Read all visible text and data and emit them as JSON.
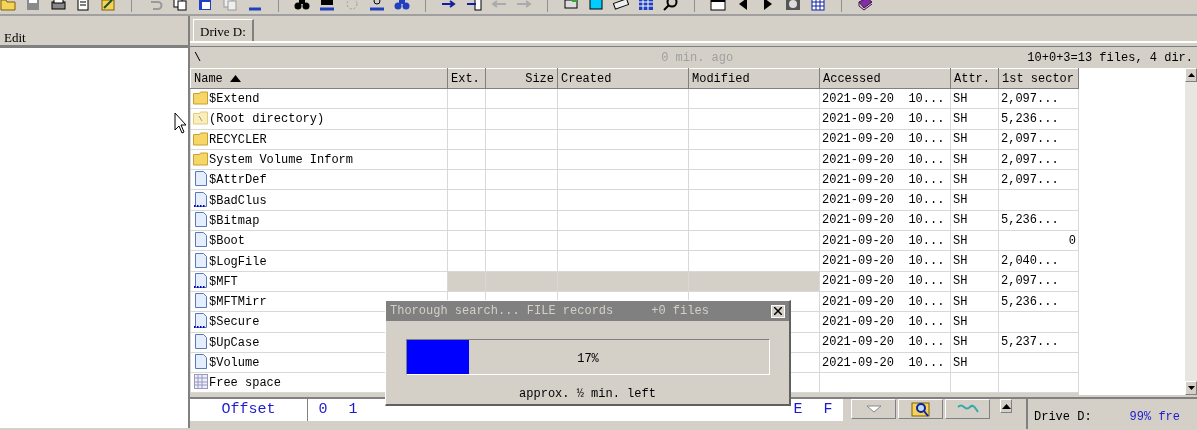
{
  "left_pane": {
    "menu": "Edit"
  },
  "tab": {
    "label": "Drive D:",
    "selected": true
  },
  "path_bar": {
    "path": "\\",
    "updated": "0 min. ago",
    "summary": "10+0+3=13 files, 4 dir."
  },
  "table": {
    "columns": [
      {
        "label": "Name",
        "sorted": true
      },
      {
        "label": "Ext.",
        "sorted": false
      },
      {
        "label": "Size",
        "sorted": false
      },
      {
        "label": "Created",
        "sorted": false
      },
      {
        "label": "Modified",
        "sorted": false
      },
      {
        "label": "Accessed",
        "sorted": false
      },
      {
        "label": "Attr.",
        "sorted": false
      },
      {
        "label": "1st sector",
        "sorted": false
      }
    ],
    "rows": [
      {
        "kind": "folder",
        "name": "$Extend",
        "accessed": "2021-09-20  10...",
        "attr": "SH",
        "first_sector": "2,097...",
        "selected": false
      },
      {
        "kind": "root",
        "name": "(Root directory)",
        "accessed": "2021-09-20  10...",
        "attr": "SH",
        "first_sector": "5,236...",
        "selected": false
      },
      {
        "kind": "folder",
        "name": "RECYCLER",
        "accessed": "2021-09-20  10...",
        "attr": "SH",
        "first_sector": "2,097...",
        "selected": false
      },
      {
        "kind": "folder",
        "name": "System Volume Inform",
        "accessed": "2021-09-20  10...",
        "attr": "SH",
        "first_sector": "2,097...",
        "selected": false
      },
      {
        "kind": "file",
        "name": "$AttrDef",
        "accessed": "2021-09-20  10...",
        "attr": "SH",
        "first_sector": "2,097...",
        "selected": false
      },
      {
        "kind": "partial",
        "name": "$BadClus",
        "accessed": "2021-09-20  10...",
        "attr": "SH",
        "selected": false
      },
      {
        "kind": "file",
        "name": "$Bitmap",
        "accessed": "2021-09-20  10...",
        "attr": "SH",
        "first_sector": "5,236...",
        "selected": false
      },
      {
        "kind": "file",
        "name": "$Boot",
        "accessed": "2021-09-20  10...",
        "attr": "SH",
        "first_sector": "0",
        "selected": false
      },
      {
        "kind": "file",
        "name": "$LogFile",
        "accessed": "2021-09-20  10...",
        "attr": "SH",
        "first_sector": "2,040...",
        "selected": false
      },
      {
        "kind": "partial",
        "name": "$MFT",
        "accessed": "2021-09-20  10...",
        "attr": "SH",
        "first_sector": "2,097...",
        "selected": true
      },
      {
        "kind": "file",
        "name": "$MFTMirr",
        "accessed": "2021-09-20  10...",
        "attr": "SH",
        "first_sector": "5,236...",
        "selected": false
      },
      {
        "kind": "partial",
        "name": "$Secure",
        "accessed": "2021-09-20  10...",
        "attr": "SH",
        "selected": false
      },
      {
        "kind": "file",
        "name": "$UpCase",
        "accessed": "2021-09-20  10...",
        "attr": "SH",
        "first_sector": "5,237...",
        "selected": false
      },
      {
        "kind": "file",
        "name": "$Volume",
        "accessed": "2021-09-20  10...",
        "attr": "SH",
        "selected": false
      },
      {
        "kind": "free",
        "name": "Free space",
        "selected": false
      }
    ]
  },
  "hex_header": {
    "offset": "Offset",
    "left_digits": [
      "0",
      "1"
    ],
    "right_digits": [
      "E",
      "F"
    ]
  },
  "info_panel": {
    "title": "Drive D:",
    "free": "99% fre"
  },
  "dialog": {
    "title": "Thorough search... FILE records",
    "count": "+0 files",
    "level": 0.17,
    "percent": "17%",
    "remaining": "approx. ½ min. left"
  }
}
